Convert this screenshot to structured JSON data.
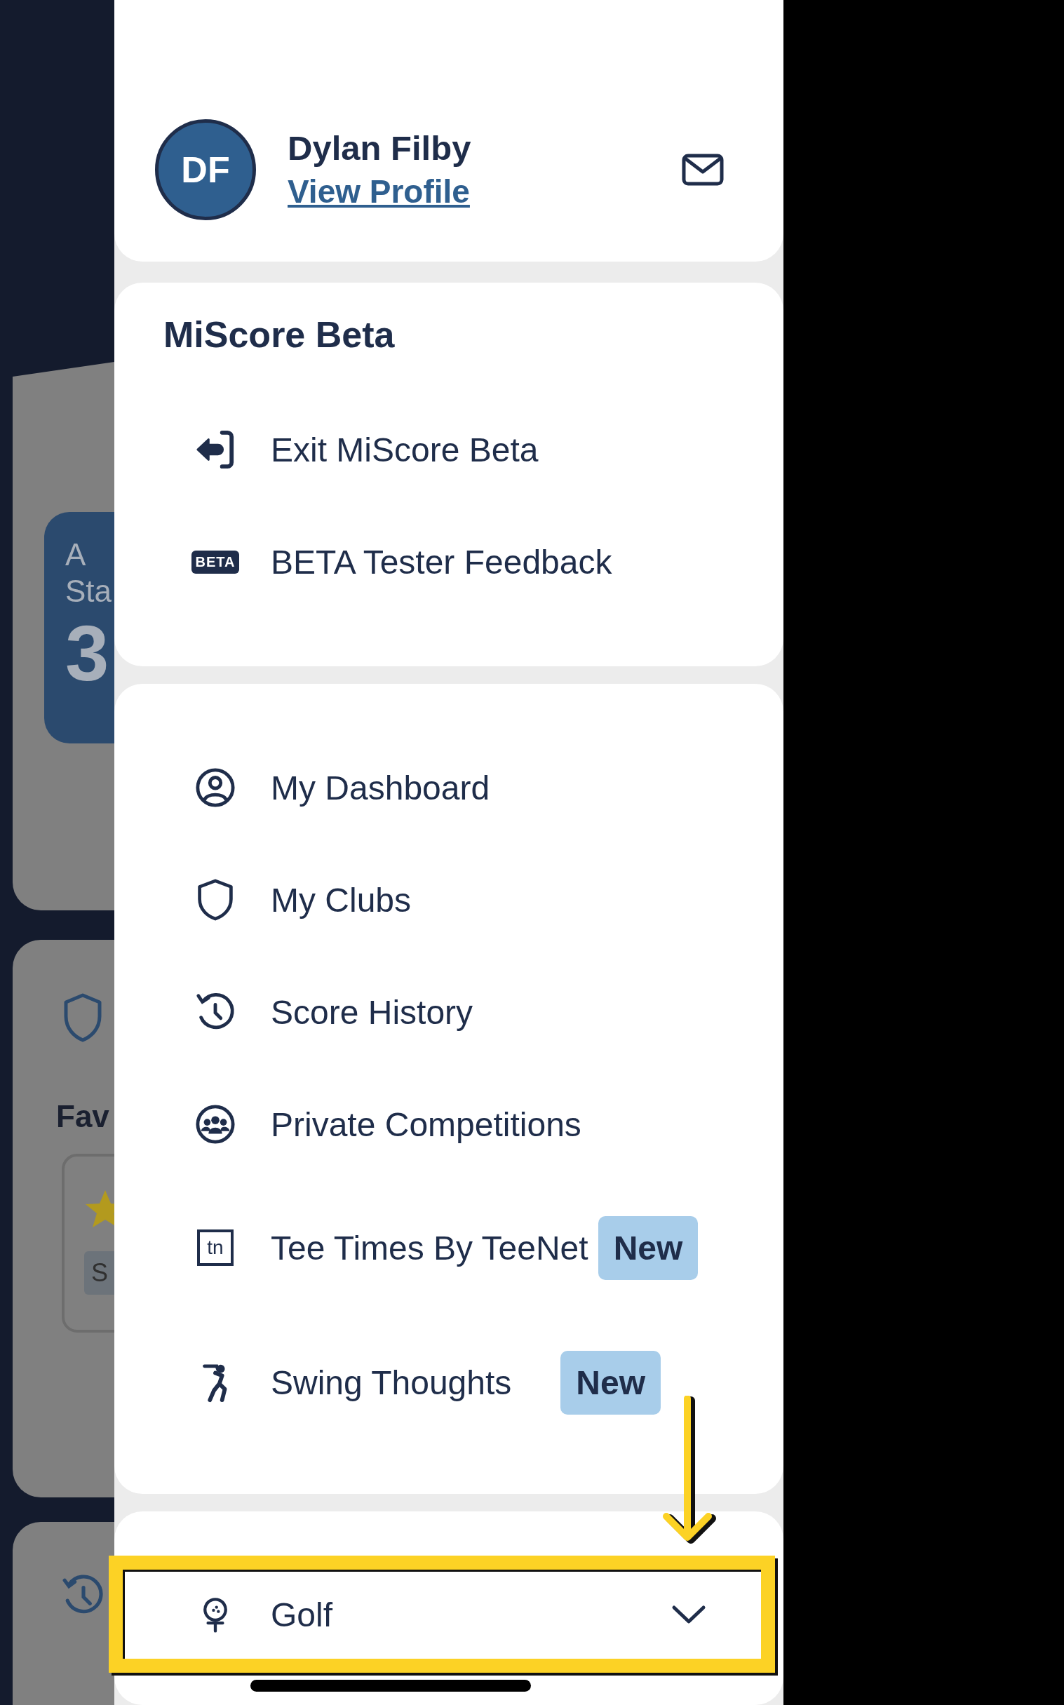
{
  "background": {
    "stat_card": {
      "label_lines": [
        "A",
        "Sta"
      ],
      "value": "3"
    },
    "favourites": {
      "title": "Fav",
      "chip": "S"
    }
  },
  "profile": {
    "initials": "DF",
    "name": "Dylan Filby",
    "link": "View Profile"
  },
  "beta_section": {
    "title": "MiScore Beta",
    "items": [
      {
        "label": "Exit MiScore Beta"
      },
      {
        "label": "BETA Tester Feedback",
        "icon_text": "BETA"
      }
    ]
  },
  "menu": {
    "items": [
      {
        "label": "My Dashboard"
      },
      {
        "label": "My Clubs"
      },
      {
        "label": "Score History"
      },
      {
        "label": "Private Competitions"
      },
      {
        "label": "Tee Times By TeeNet",
        "icon_text": "tn",
        "badge": "New"
      },
      {
        "label": "Swing Thoughts",
        "badge": "New"
      }
    ]
  },
  "sport_selector": {
    "label": "Golf",
    "expanded": false,
    "highlighted": true
  }
}
